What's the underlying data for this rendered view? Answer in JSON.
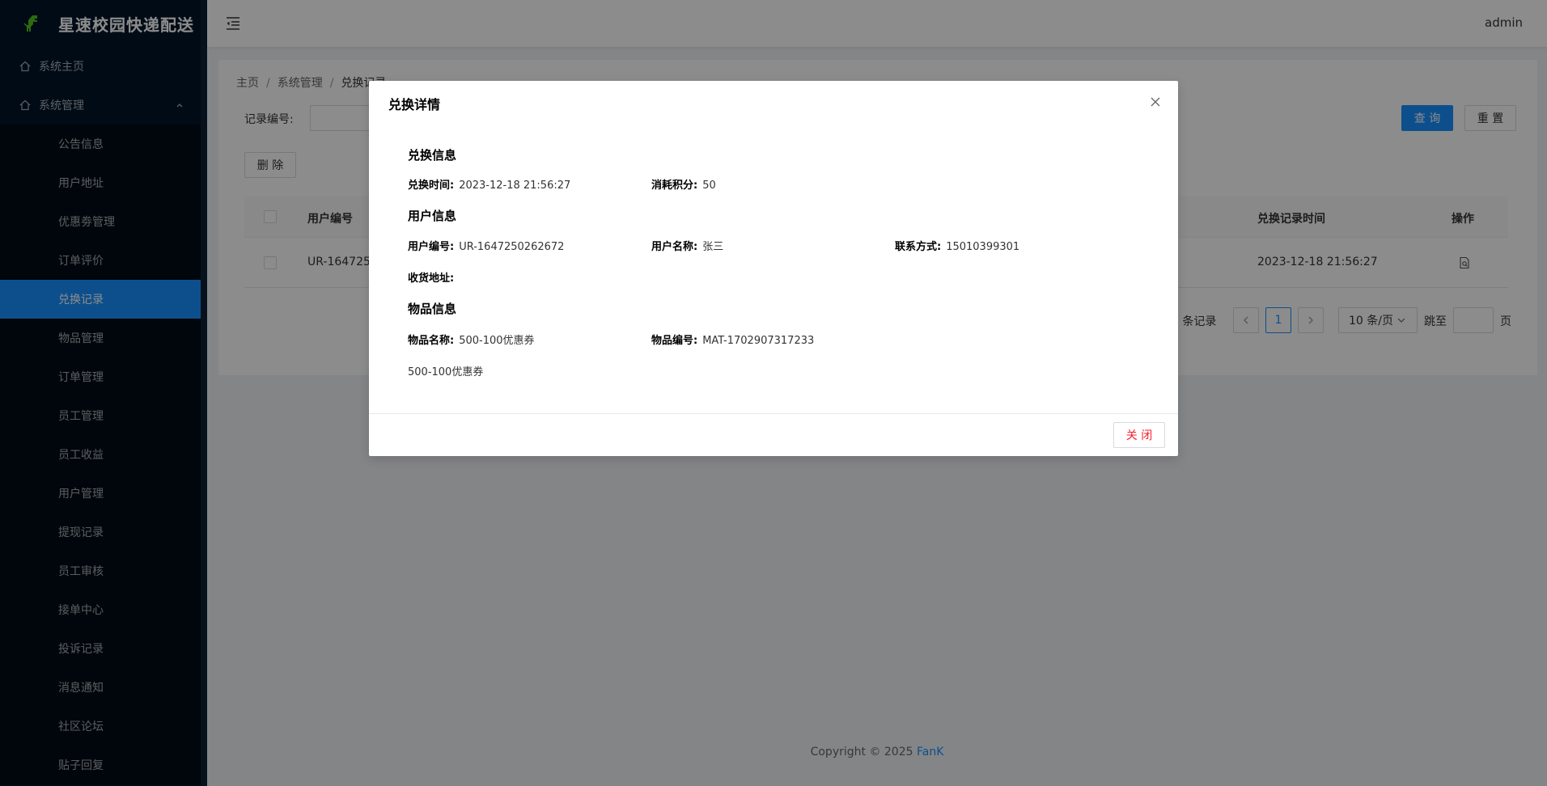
{
  "app": {
    "title": "星速校园快递配送",
    "user": "admin"
  },
  "sidebar": {
    "home": "系统主页",
    "system": "系统管理",
    "items": [
      {
        "label": "公告信息"
      },
      {
        "label": "用户地址"
      },
      {
        "label": "优惠劵管理"
      },
      {
        "label": "订单评价"
      },
      {
        "label": "兑换记录",
        "active": true
      },
      {
        "label": "物品管理"
      },
      {
        "label": "订单管理"
      },
      {
        "label": "员工管理"
      },
      {
        "label": "员工收益"
      },
      {
        "label": "用户管理"
      },
      {
        "label": "提现记录"
      },
      {
        "label": "员工审核"
      },
      {
        "label": "接单中心"
      },
      {
        "label": "投诉记录"
      },
      {
        "label": "消息通知"
      },
      {
        "label": "社区论坛"
      },
      {
        "label": "贴子回复"
      }
    ]
  },
  "breadcrumb": {
    "home": "主页",
    "system": "系统管理",
    "current": "兑换记录"
  },
  "search": {
    "label": "记录编号:",
    "placeholder": "",
    "query": "查 询",
    "reset": "重 置"
  },
  "toolbar": {
    "delete": "删 除"
  },
  "table": {
    "headers": {
      "user_no": "用户编号",
      "time": "兑换记录时间",
      "ops": "操作"
    },
    "rows": [
      {
        "user_no": "UR-1647250262672",
        "user_no_visible": "UR-164725",
        "time": "2023-12-18 21:56:27"
      }
    ]
  },
  "pager": {
    "total_text": "共 1 条记录",
    "total_visible": "1 条记录",
    "page": "1",
    "size": "10 条/页",
    "jump": "跳至",
    "page_unit": "页"
  },
  "footer": {
    "copyright": "Copyright © 2025",
    "brand": "FanK"
  },
  "modal": {
    "title": "兑换详情",
    "exchange": {
      "title": "兑换信息",
      "time_label": "兑换时间:",
      "time": "2023-12-18 21:56:27",
      "points_label": "消耗积分:",
      "points": "50"
    },
    "user": {
      "title": "用户信息",
      "no_label": "用户编号:",
      "no": "UR-1647250262672",
      "name_label": "用户名称:",
      "name": "张三",
      "phone_label": "联系方式:",
      "phone": "15010399301",
      "address_label": "收货地址:",
      "address": ""
    },
    "item": {
      "title": "物品信息",
      "name_label": "物品名称:",
      "name": "500-100优惠券",
      "no_label": "物品编号:",
      "no": "MAT-1702907317233",
      "desc": "500-100优惠券"
    },
    "close": "关 闭"
  },
  "colors": {
    "primary": "#1890ff",
    "sidebar": "#001529",
    "danger": "#f5222d"
  }
}
